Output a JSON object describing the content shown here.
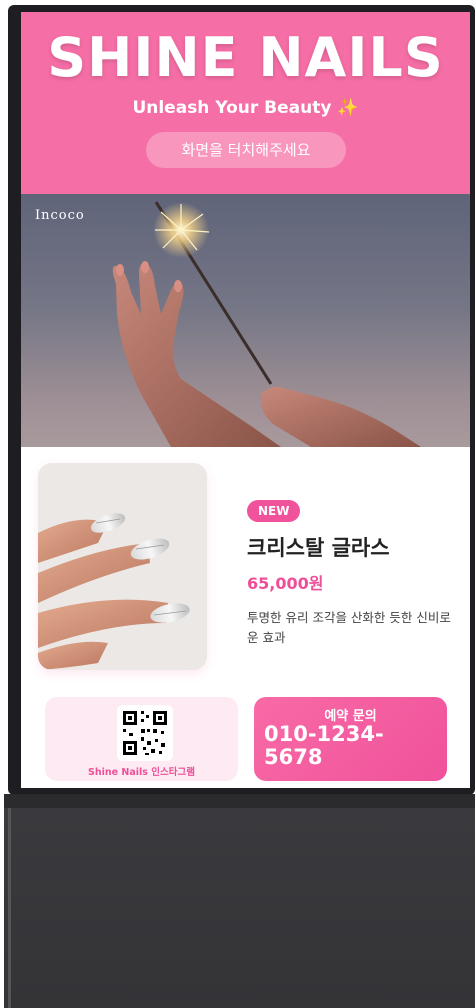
{
  "header": {
    "brand": "SHINE NAILS",
    "tagline": "Unleash Your Beauty",
    "sparkle_icon": "✨",
    "touch_prompt": "화면을 터치해주세요",
    "bg_color": "#f56ea5"
  },
  "hero": {
    "brand_label": "Incoco",
    "image": "hands-with-sparkler"
  },
  "product": {
    "image": "silver-striped-nails",
    "badge": "NEW",
    "name": "크리스탈 글라스",
    "price": "65,000원",
    "description": "투명한 유리 조각을 산화한 듯한 신비로운 효과"
  },
  "qr": {
    "icon": "qr-code-icon",
    "label": "Shine Nails 인스타그램"
  },
  "contact": {
    "label": "예약 문의",
    "phone": "010-1234-5678"
  },
  "colors": {
    "accent": "#f0529b",
    "pink_light": "#fdeaf2"
  }
}
